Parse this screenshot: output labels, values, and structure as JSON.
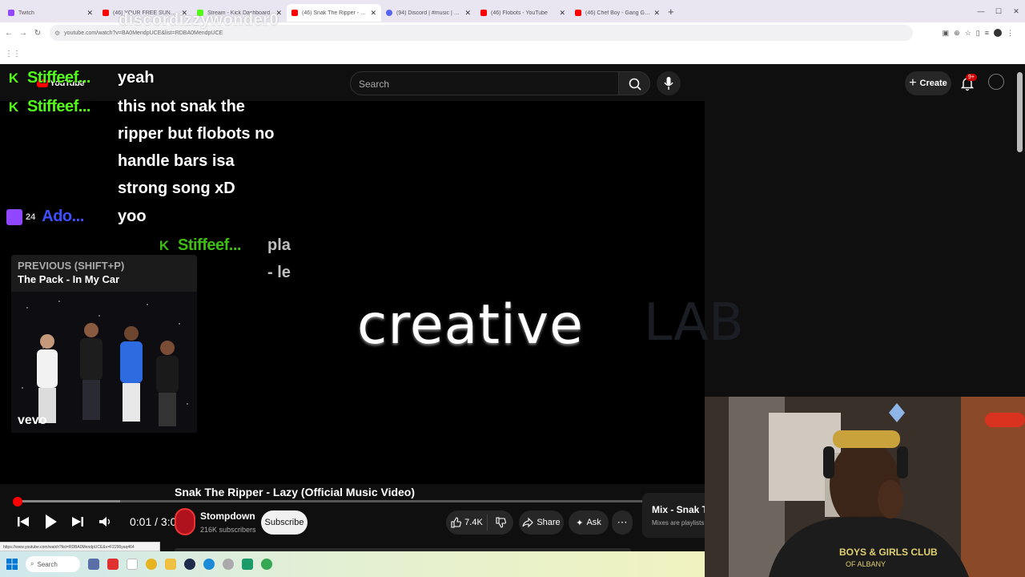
{
  "browser": {
    "tabs": [
      {
        "label": "Twitch",
        "color": "#9146ff",
        "active": false
      },
      {
        "label": "(46) YOUR FREE SUNDAY FUN",
        "color": "#ff0000",
        "active": false
      },
      {
        "label": "Stream - Kick Dashboard",
        "color": "#53fc18",
        "active": false
      },
      {
        "label": "(46) Snak The Ripper - Lazy (Of",
        "color": "#ff0000",
        "active": true
      },
      {
        "label": "(94) Discord | #music | 15th",
        "color": "#5865f2",
        "active": false
      },
      {
        "label": "(46) Flobots - YouTube",
        "color": "#ff0000",
        "active": false
      },
      {
        "label": "(46) Chef Boy - Gang Gang (Of",
        "color": "#ff0000",
        "active": false
      }
    ],
    "url": "youtube.com/watch?v=BA0MendpUCE&list=RDBA0MendpUCE",
    "status_url": "https://www.youtube.com/watch?list=RDBA0MendpUCE&v=F2290yaq464"
  },
  "overlay": {
    "watermark": "discordizzywonder0"
  },
  "youtube": {
    "logo": "YouTube",
    "search_placeholder": "Search",
    "create_label": "Create",
    "notif_count": "9+",
    "video_title": "Snak The Ripper - Lazy (Official Music Video)",
    "uploader": "Stompdown",
    "subscribers": "216K subscribers",
    "subscribe_label": "Subscribe",
    "likes": "7.4K",
    "share_label": "Share",
    "ask_label": "Ask",
    "mix_title": "Mix - Snak T",
    "mix_sub": "Mixes are playlists Y",
    "time": "0:01 / 3:05",
    "progress_fraction": 0.005,
    "video_text_1": "creative",
    "video_text_2": "LAB",
    "prev_label": "PREVIOUS (SHIFT+P)",
    "prev_title": "The Pack - In My Car",
    "prev_brand": "vevo"
  },
  "chat": [
    {
      "user": "Stiffeef...",
      "platform": "kick",
      "lines": [
        "yeah"
      ]
    },
    {
      "user": "Stiffeef...",
      "platform": "kick",
      "lines": [
        "this not snak the",
        "ripper but flobots no",
        "handle bars isa",
        "strong song xD"
      ]
    },
    {
      "user": "Ado...",
      "platform": "twitch",
      "badge": "24",
      "lines": [
        "yoo"
      ]
    },
    {
      "user": "Stiffeef...",
      "platform": "kick",
      "lines": [
        "pla",
        "- le"
      ]
    }
  ],
  "taskbar": {
    "search_label": "Search"
  }
}
